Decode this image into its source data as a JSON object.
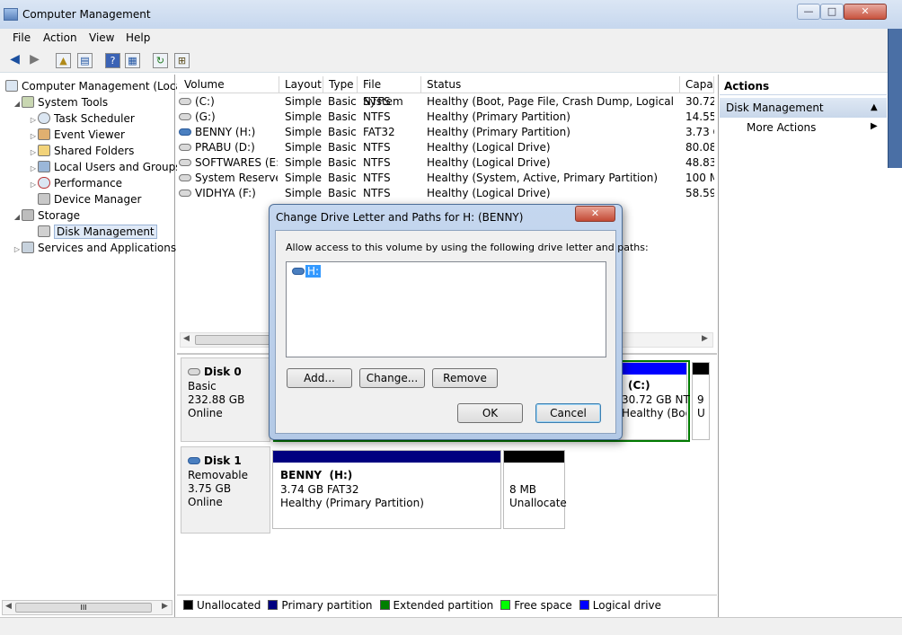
{
  "window": {
    "title": "Computer Management",
    "min": "—",
    "max": "□",
    "close": "✕"
  },
  "menu": [
    "File",
    "Action",
    "View",
    "Help"
  ],
  "toolbar": {
    "back": "◀",
    "forward": "▶",
    "up": "▲",
    "props": "▤",
    "help": "?",
    "pane": "▦",
    "refresh": "↻",
    "export": "⊞"
  },
  "tree": {
    "root": "Computer Management (Local",
    "system_tools": "System Tools",
    "task_scheduler": "Task Scheduler",
    "event_viewer": "Event Viewer",
    "shared_folders": "Shared Folders",
    "local_users": "Local Users and Groups",
    "performance": "Performance",
    "device_manager": "Device Manager",
    "storage": "Storage",
    "disk_management": "Disk Management",
    "services": "Services and Applications",
    "scroll_thumb": "III"
  },
  "volume_table": {
    "headers": [
      "Volume",
      "Layout",
      "Type",
      "File System",
      "Status",
      "Capac"
    ],
    "rows": [
      {
        "volume": "(C:)",
        "layout": "Simple",
        "type": "Basic",
        "fs": "NTFS",
        "status": "Healthy (Boot, Page File, Crash Dump, Logical Drive)",
        "capacity": "30.72",
        "icon": "disk-icon"
      },
      {
        "volume": "(G:)",
        "layout": "Simple",
        "type": "Basic",
        "fs": "NTFS",
        "status": "Healthy (Primary Partition)",
        "capacity": "14.55",
        "icon": "disk-icon"
      },
      {
        "volume": "BENNY (H:)",
        "layout": "Simple",
        "type": "Basic",
        "fs": "FAT32",
        "status": "Healthy (Primary Partition)",
        "capacity": "3.73 G",
        "icon": "removable-disk-icon"
      },
      {
        "volume": "PRABU (D:)",
        "layout": "Simple",
        "type": "Basic",
        "fs": "NTFS",
        "status": "Healthy (Logical Drive)",
        "capacity": "80.08",
        "icon": "disk-icon"
      },
      {
        "volume": "SOFTWARES (E:)",
        "layout": "Simple",
        "type": "Basic",
        "fs": "NTFS",
        "status": "Healthy (Logical Drive)",
        "capacity": "48.83",
        "icon": "disk-icon"
      },
      {
        "volume": "System Reserved",
        "layout": "Simple",
        "type": "Basic",
        "fs": "NTFS",
        "status": "Healthy (System, Active, Primary Partition)",
        "capacity": "100 M",
        "icon": "disk-icon"
      },
      {
        "volume": "VIDHYA (F:)",
        "layout": "Simple",
        "type": "Basic",
        "fs": "NTFS",
        "status": "Healthy (Logical Drive)",
        "capacity": "58.59",
        "icon": "disk-icon"
      }
    ]
  },
  "disk0": {
    "name": "Disk 0",
    "kind": "Basic",
    "size": "232.88 GB",
    "state": "Online",
    "c_part": {
      "name": "(C:)",
      "size": "30.72 GB NT",
      "status": "Healthy (Boo"
    },
    "small_part": {
      "line1": "9",
      "line2": "U"
    }
  },
  "disk1": {
    "name": "Disk 1",
    "kind": "Removable",
    "size": "3.75 GB",
    "state": "Online",
    "benny": {
      "name": "BENNY  (H:)",
      "size": "3.74 GB FAT32",
      "status": "Healthy (Primary Partition)"
    },
    "unalloc": {
      "size": "8 MB",
      "status": "Unallocate"
    }
  },
  "legend": [
    {
      "label": "Unallocated",
      "color": "#000000"
    },
    {
      "label": "Primary partition",
      "color": "#000080"
    },
    {
      "label": "Extended partition",
      "color": "#008000"
    },
    {
      "label": "Free space",
      "color": "#00ff00"
    },
    {
      "label": "Logical drive",
      "color": "#0000ff"
    }
  ],
  "actions": {
    "header": "Actions",
    "section": "Disk Management",
    "more": "More Actions"
  },
  "dialog": {
    "title": "Change Drive Letter and Paths for H: (BENNY)",
    "instruction": "Allow access to this volume by using the following drive letter and paths:",
    "list_item": "H:",
    "add": "Add...",
    "change": "Change...",
    "remove": "Remove",
    "ok": "OK",
    "cancel": "Cancel",
    "close": "✕"
  }
}
